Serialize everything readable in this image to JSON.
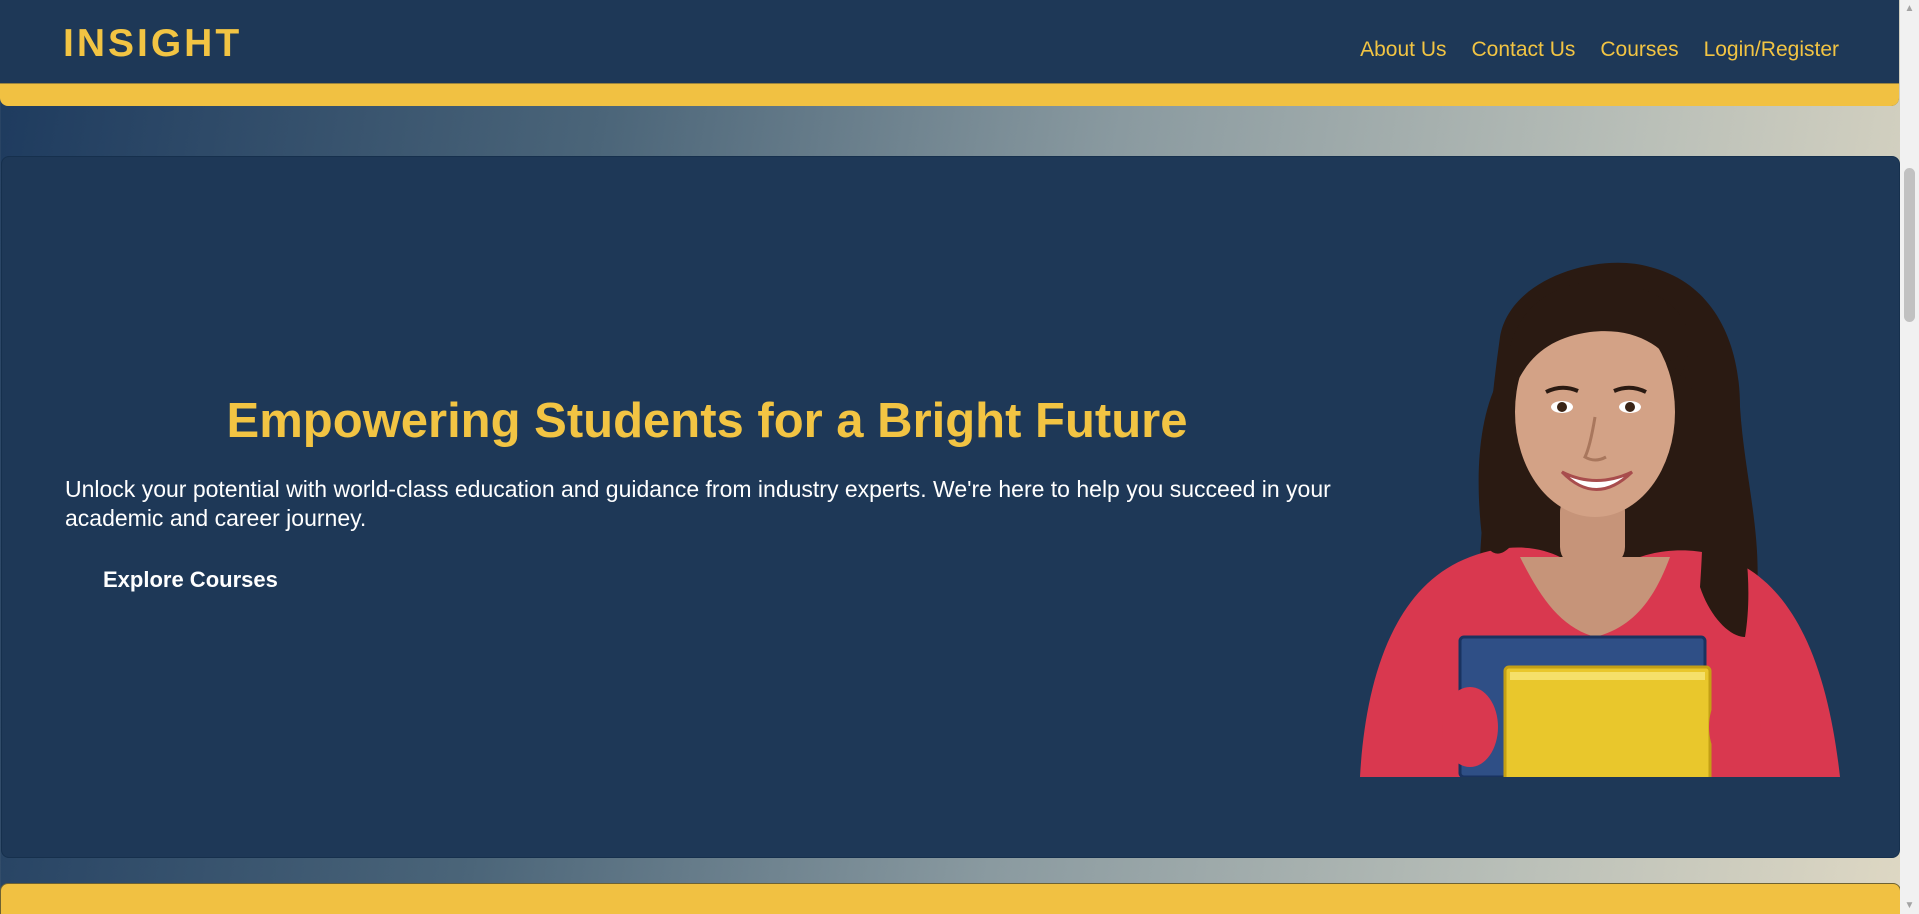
{
  "header": {
    "logo": "INSIGHT",
    "nav": [
      {
        "label": "About Us"
      },
      {
        "label": "Contact Us"
      },
      {
        "label": "Courses"
      },
      {
        "label": "Login/Register"
      }
    ]
  },
  "hero": {
    "title": "Empowering Students for a Bright Future",
    "text": "Unlock your potential with world-class education and guidance from industry experts. We're here to help you succeed in your academic and career journey.",
    "button_label": "Explore Courses",
    "image": "student-with-books-photo"
  },
  "scrollbar": {
    "up_icon": "scroll-up-arrow-icon",
    "down_icon": "scroll-down-arrow-icon"
  },
  "colors": {
    "navy": "#1e3857",
    "accent_yellow": "#f2c443",
    "text_white": "#ffffff"
  }
}
